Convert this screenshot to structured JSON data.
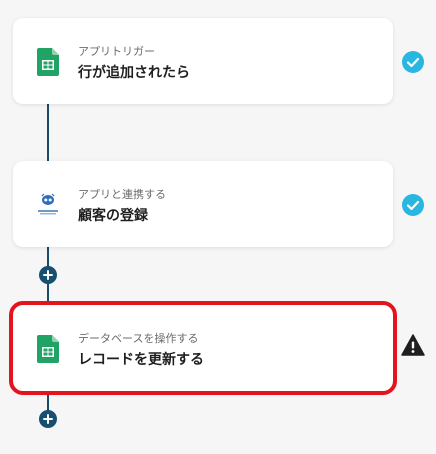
{
  "steps": [
    {
      "subtitle": "アプリトリガー",
      "title": "行が追加されたら",
      "icon": "google-sheets-icon",
      "status": "completed"
    },
    {
      "subtitle": "アプリと連携する",
      "title": "顧客の登録",
      "icon": "crm-app-icon",
      "status": "completed"
    },
    {
      "subtitle": "データベースを操作する",
      "title": "レコードを更新する",
      "icon": "google-sheets-icon",
      "status": "warning"
    }
  ],
  "colors": {
    "background": "#f6f6f7",
    "check": "#27b7e0",
    "highlight": "#e3141e",
    "connector": "#1b4a6b",
    "sheets_green": "#21a366"
  }
}
